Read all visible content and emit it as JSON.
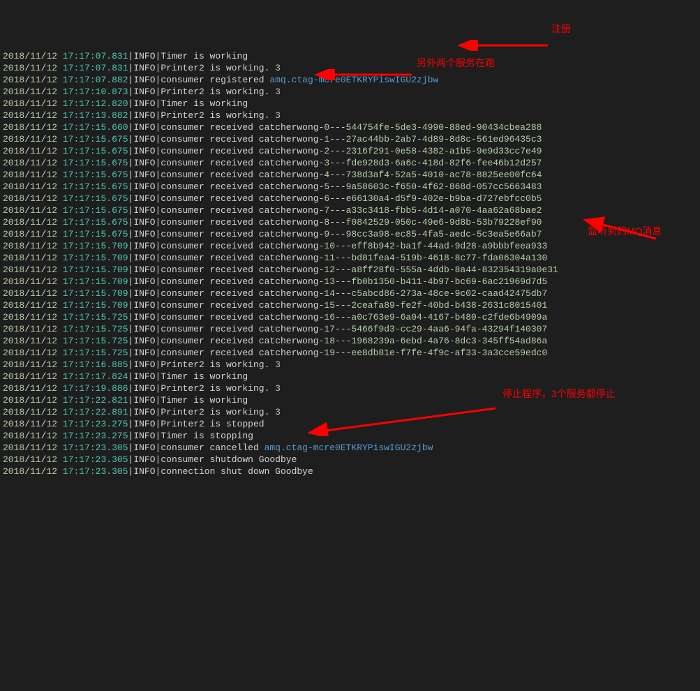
{
  "annotations": {
    "register": "注册",
    "running": "另外两个服务在跑",
    "mq": "监听到的MQ消息",
    "stop": "停止程序，3个服务都停止"
  },
  "logs": [
    {
      "y": "2018",
      "m": "11",
      "d": "12",
      "t": "17:17:07.831",
      "lvl": "INFO",
      "parts": [
        {
          "c": "msg",
          "v": "Timer is working"
        }
      ]
    },
    {
      "y": "2018",
      "m": "11",
      "d": "12",
      "t": "17:17:07.831",
      "lvl": "INFO",
      "parts": [
        {
          "c": "msg",
          "v": "Printer2 is working. "
        },
        {
          "c": "num",
          "v": "3"
        }
      ]
    },
    {
      "y": "2018",
      "m": "11",
      "d": "12",
      "t": "17:17:07.882",
      "lvl": "INFO",
      "parts": [
        {
          "c": "msg",
          "v": "consumer registered "
        },
        {
          "c": "tag",
          "v": "amq.ctag-mcre0ETKRYPiswIGU2zjbw"
        }
      ]
    },
    {
      "y": "2018",
      "m": "11",
      "d": "12",
      "t": "17:17:10.873",
      "lvl": "INFO",
      "parts": [
        {
          "c": "msg",
          "v": "Printer2 is working. "
        },
        {
          "c": "num",
          "v": "3"
        }
      ]
    },
    {
      "y": "2018",
      "m": "11",
      "d": "12",
      "t": "17:17:12.820",
      "lvl": "INFO",
      "parts": [
        {
          "c": "msg",
          "v": "Timer is working"
        }
      ]
    },
    {
      "y": "2018",
      "m": "11",
      "d": "12",
      "t": "17:17:13.882",
      "lvl": "INFO",
      "parts": [
        {
          "c": "msg",
          "v": "Printer2 is working. "
        },
        {
          "c": "num",
          "v": "3"
        }
      ]
    },
    {
      "y": "2018",
      "m": "11",
      "d": "12",
      "t": "17:17:15.660",
      "lvl": "INFO",
      "parts": [
        {
          "c": "msg",
          "v": "consumer received catcherwong-"
        },
        {
          "c": "num",
          "v": "0"
        },
        {
          "c": "msg",
          "v": "---"
        },
        {
          "c": "hash",
          "v": "544754fe-5de3-4990-88ed-90434cbea288"
        }
      ]
    },
    {
      "y": "2018",
      "m": "11",
      "d": "12",
      "t": "17:17:15.675",
      "lvl": "INFO",
      "parts": [
        {
          "c": "msg",
          "v": "consumer received catcherwong-"
        },
        {
          "c": "num",
          "v": "1"
        },
        {
          "c": "msg",
          "v": "---"
        },
        {
          "c": "hash",
          "v": "27ac44bb-2ab7-4d89-8d8c-561ed96435c3"
        }
      ]
    },
    {
      "y": "2018",
      "m": "11",
      "d": "12",
      "t": "17:17:15.675",
      "lvl": "INFO",
      "parts": [
        {
          "c": "msg",
          "v": "consumer received catcherwong-"
        },
        {
          "c": "num",
          "v": "2"
        },
        {
          "c": "msg",
          "v": "---"
        },
        {
          "c": "hash",
          "v": "2316f291-0e58-4382-a1b5-9e9d33cc7e49"
        }
      ]
    },
    {
      "y": "2018",
      "m": "11",
      "d": "12",
      "t": "17:17:15.675",
      "lvl": "INFO",
      "parts": [
        {
          "c": "msg",
          "v": "consumer received catcherwong-"
        },
        {
          "c": "num",
          "v": "3"
        },
        {
          "c": "msg",
          "v": "---"
        },
        {
          "c": "hash",
          "v": "fde928d3-6a6c-418d-82f6-fee46b12d257"
        }
      ]
    },
    {
      "y": "2018",
      "m": "11",
      "d": "12",
      "t": "17:17:15.675",
      "lvl": "INFO",
      "parts": [
        {
          "c": "msg",
          "v": "consumer received catcherwong-"
        },
        {
          "c": "num",
          "v": "4"
        },
        {
          "c": "msg",
          "v": "---"
        },
        {
          "c": "hash",
          "v": "738d3af4-52a5-4010-ac78-8825ee00fc64"
        }
      ]
    },
    {
      "y": "2018",
      "m": "11",
      "d": "12",
      "t": "17:17:15.675",
      "lvl": "INFO",
      "parts": [
        {
          "c": "msg",
          "v": "consumer received catcherwong-"
        },
        {
          "c": "num",
          "v": "5"
        },
        {
          "c": "msg",
          "v": "---"
        },
        {
          "c": "hash",
          "v": "9a58603c-f650-4f62-868d-057cc5663483"
        }
      ]
    },
    {
      "y": "2018",
      "m": "11",
      "d": "12",
      "t": "17:17:15.675",
      "lvl": "INFO",
      "parts": [
        {
          "c": "msg",
          "v": "consumer received catcherwong-"
        },
        {
          "c": "num",
          "v": "6"
        },
        {
          "c": "msg",
          "v": "---"
        },
        {
          "c": "hash",
          "v": "e66130a4-d5f9-402e-b9ba-d727ebfcc0b5"
        }
      ]
    },
    {
      "y": "2018",
      "m": "11",
      "d": "12",
      "t": "17:17:15.675",
      "lvl": "INFO",
      "parts": [
        {
          "c": "msg",
          "v": "consumer received catcherwong-"
        },
        {
          "c": "num",
          "v": "7"
        },
        {
          "c": "msg",
          "v": "---"
        },
        {
          "c": "hash",
          "v": "a33c3418-fbb5-4d14-a070-4aa62a68bae2"
        }
      ]
    },
    {
      "y": "2018",
      "m": "11",
      "d": "12",
      "t": "17:17:15.675",
      "lvl": "INFO",
      "parts": [
        {
          "c": "msg",
          "v": "consumer received catcherwong-"
        },
        {
          "c": "num",
          "v": "8"
        },
        {
          "c": "msg",
          "v": "---"
        },
        {
          "c": "hash",
          "v": "f0842529-050c-49e6-9d8b-53b79228ef90"
        }
      ]
    },
    {
      "y": "2018",
      "m": "11",
      "d": "12",
      "t": "17:17:15.675",
      "lvl": "INFO",
      "parts": [
        {
          "c": "msg",
          "v": "consumer received catcherwong-"
        },
        {
          "c": "num",
          "v": "9"
        },
        {
          "c": "msg",
          "v": "---"
        },
        {
          "c": "hash",
          "v": "98cc3a98-ec85-4fa5-aedc-5c3ea5e66ab7"
        }
      ]
    },
    {
      "y": "2018",
      "m": "11",
      "d": "12",
      "t": "17:17:15.709",
      "lvl": "INFO",
      "parts": [
        {
          "c": "msg",
          "v": "consumer received catcherwong-"
        },
        {
          "c": "num",
          "v": "10"
        },
        {
          "c": "msg",
          "v": "---"
        },
        {
          "c": "hash",
          "v": "eff8b942-ba1f-44ad-9d28-a9bbbfeea933"
        }
      ]
    },
    {
      "y": "2018",
      "m": "11",
      "d": "12",
      "t": "17:17:15.709",
      "lvl": "INFO",
      "parts": [
        {
          "c": "msg",
          "v": "consumer received catcherwong-"
        },
        {
          "c": "num",
          "v": "11"
        },
        {
          "c": "msg",
          "v": "---"
        },
        {
          "c": "hash",
          "v": "bd81fea4-519b-4618-8c77-fda06304a130"
        }
      ]
    },
    {
      "y": "2018",
      "m": "11",
      "d": "12",
      "t": "17:17:15.709",
      "lvl": "INFO",
      "parts": [
        {
          "c": "msg",
          "v": "consumer received catcherwong-"
        },
        {
          "c": "num",
          "v": "12"
        },
        {
          "c": "msg",
          "v": "---"
        },
        {
          "c": "hash",
          "v": "a8ff28f0-555a-4ddb-8a44-832354319a0e31"
        }
      ]
    },
    {
      "y": "2018",
      "m": "11",
      "d": "12",
      "t": "17:17:15.709",
      "lvl": "INFO",
      "parts": [
        {
          "c": "msg",
          "v": "consumer received catcherwong-"
        },
        {
          "c": "num",
          "v": "13"
        },
        {
          "c": "msg",
          "v": "---"
        },
        {
          "c": "hash",
          "v": "fb0b1350-b411-4b97-bc69-6ac21969d7d5"
        }
      ]
    },
    {
      "y": "2018",
      "m": "11",
      "d": "12",
      "t": "17:17:15.709",
      "lvl": "INFO",
      "parts": [
        {
          "c": "msg",
          "v": "consumer received catcherwong-"
        },
        {
          "c": "num",
          "v": "14"
        },
        {
          "c": "msg",
          "v": "---"
        },
        {
          "c": "hash",
          "v": "c5abcd86-273a-48ce-9c02-caad42475db7"
        }
      ]
    },
    {
      "y": "2018",
      "m": "11",
      "d": "12",
      "t": "17:17:15.709",
      "lvl": "INFO",
      "parts": [
        {
          "c": "msg",
          "v": "consumer received catcherwong-"
        },
        {
          "c": "num",
          "v": "15"
        },
        {
          "c": "msg",
          "v": "---"
        },
        {
          "c": "hash",
          "v": "2ceafa89-fe2f-40bd-b438-2631c8015401"
        }
      ]
    },
    {
      "y": "2018",
      "m": "11",
      "d": "12",
      "t": "17:17:15.725",
      "lvl": "INFO",
      "parts": [
        {
          "c": "msg",
          "v": "consumer received catcherwong-"
        },
        {
          "c": "num",
          "v": "16"
        },
        {
          "c": "msg",
          "v": "---"
        },
        {
          "c": "hash",
          "v": "a0c763e9-6a04-4167-b480-c2fde6b4909a"
        }
      ]
    },
    {
      "y": "2018",
      "m": "11",
      "d": "12",
      "t": "17:17:15.725",
      "lvl": "INFO",
      "parts": [
        {
          "c": "msg",
          "v": "consumer received catcherwong-"
        },
        {
          "c": "num",
          "v": "17"
        },
        {
          "c": "msg",
          "v": "---"
        },
        {
          "c": "hash",
          "v": "5466f9d3-cc29-4aa6-94fa-43294f140307"
        }
      ]
    },
    {
      "y": "2018",
      "m": "11",
      "d": "12",
      "t": "17:17:15.725",
      "lvl": "INFO",
      "parts": [
        {
          "c": "msg",
          "v": "consumer received catcherwong-"
        },
        {
          "c": "num",
          "v": "18"
        },
        {
          "c": "msg",
          "v": "---"
        },
        {
          "c": "hash",
          "v": "1968239a-6ebd-4a76-8dc3-345ff54ad86a"
        }
      ]
    },
    {
      "y": "2018",
      "m": "11",
      "d": "12",
      "t": "17:17:15.725",
      "lvl": "INFO",
      "parts": [
        {
          "c": "msg",
          "v": "consumer received catcherwong-"
        },
        {
          "c": "num",
          "v": "19"
        },
        {
          "c": "msg",
          "v": "---"
        },
        {
          "c": "hash",
          "v": "ee8db81e-f7fe-4f9c-af33-3a3cce59edc0"
        }
      ]
    },
    {
      "y": "2018",
      "m": "11",
      "d": "12",
      "t": "17:17:16.885",
      "lvl": "INFO",
      "parts": [
        {
          "c": "msg",
          "v": "Printer2 is working. "
        },
        {
          "c": "num",
          "v": "3"
        }
      ]
    },
    {
      "y": "2018",
      "m": "11",
      "d": "12",
      "t": "17:17:17.824",
      "lvl": "INFO",
      "parts": [
        {
          "c": "msg",
          "v": "Timer is working"
        }
      ]
    },
    {
      "y": "2018",
      "m": "11",
      "d": "12",
      "t": "17:17:19.886",
      "lvl": "INFO",
      "parts": [
        {
          "c": "msg",
          "v": "Printer2 is working. "
        },
        {
          "c": "num",
          "v": "3"
        }
      ]
    },
    {
      "y": "2018",
      "m": "11",
      "d": "12",
      "t": "17:17:22.821",
      "lvl": "INFO",
      "parts": [
        {
          "c": "msg",
          "v": "Timer is working"
        }
      ]
    },
    {
      "y": "2018",
      "m": "11",
      "d": "12",
      "t": "17:17:22.891",
      "lvl": "INFO",
      "parts": [
        {
          "c": "msg",
          "v": "Printer2 is working. "
        },
        {
          "c": "num",
          "v": "3"
        }
      ]
    },
    {
      "y": "2018",
      "m": "11",
      "d": "12",
      "t": "17:17:23.275",
      "lvl": "INFO",
      "parts": [
        {
          "c": "msg",
          "v": "Printer2 is stopped"
        }
      ]
    },
    {
      "y": "2018",
      "m": "11",
      "d": "12",
      "t": "17:17:23.275",
      "lvl": "INFO",
      "parts": [
        {
          "c": "msg",
          "v": "Timer is stopping"
        }
      ]
    },
    {
      "y": "2018",
      "m": "11",
      "d": "12",
      "t": "17:17:23.305",
      "lvl": "INFO",
      "parts": [
        {
          "c": "msg",
          "v": "consumer cancelled "
        },
        {
          "c": "tag",
          "v": "amq.ctag-mcre0ETKRYPiswIGU2zjbw"
        }
      ]
    },
    {
      "y": "2018",
      "m": "11",
      "d": "12",
      "t": "17:17:23.305",
      "lvl": "INFO",
      "parts": [
        {
          "c": "msg",
          "v": "consumer shutdown Goodbye"
        }
      ]
    },
    {
      "y": "2018",
      "m": "11",
      "d": "12",
      "t": "17:17:23.305",
      "lvl": "INFO",
      "parts": [
        {
          "c": "msg",
          "v": "connection shut down Goodbye"
        }
      ]
    }
  ]
}
